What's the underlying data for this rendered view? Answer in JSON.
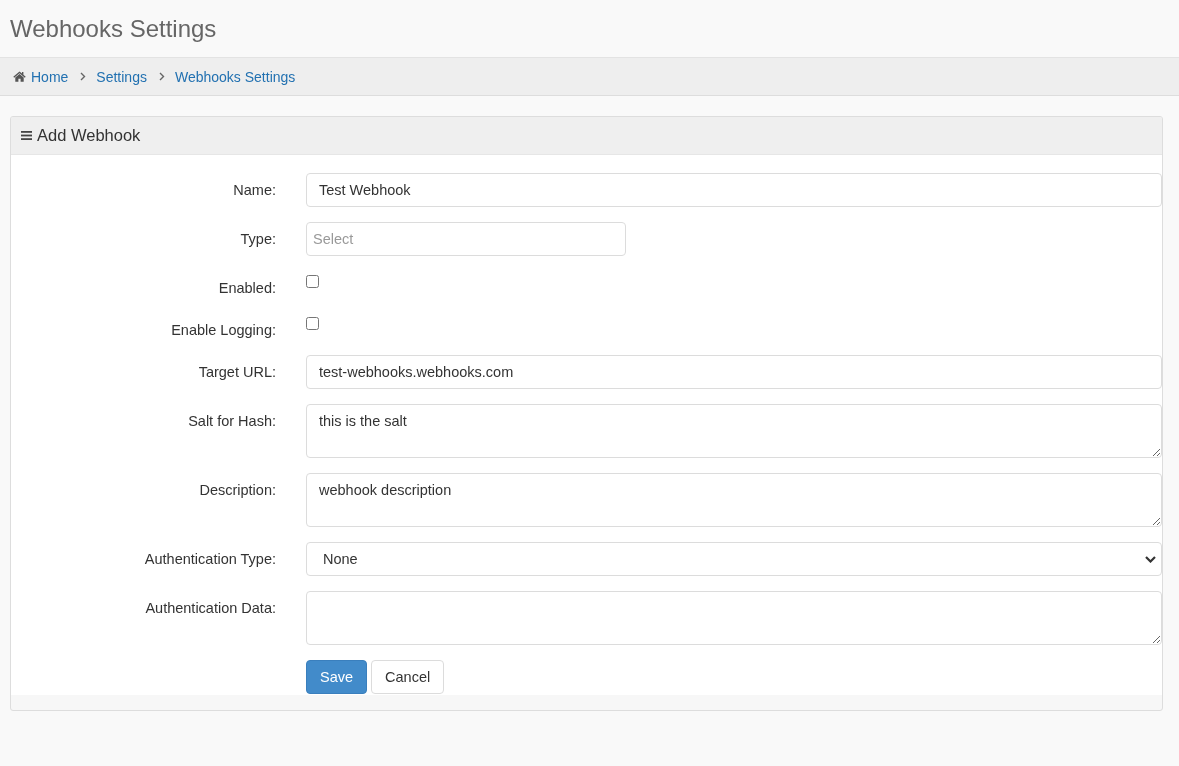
{
  "page_title": "Webhooks Settings",
  "breadcrumb": [
    {
      "label": "Home",
      "kind": "home"
    },
    {
      "label": "Settings",
      "kind": "link"
    },
    {
      "label": "Webhooks Settings",
      "kind": "link"
    }
  ],
  "panel": {
    "title": "Add Webhook",
    "fields": [
      {
        "kind": "text",
        "label": "Name:",
        "value": "Test Webhook"
      },
      {
        "kind": "combobox",
        "label": "Type:",
        "placeholder": "Select"
      },
      {
        "kind": "checkbox",
        "label": "Enabled:",
        "checked": false
      },
      {
        "kind": "checkbox",
        "label": "Enable Logging:",
        "checked": false
      },
      {
        "kind": "text",
        "label": "Target URL:",
        "value": "test-webhooks.webhooks.com"
      },
      {
        "kind": "textarea",
        "label": "Salt for Hash:",
        "value": "this is the salt"
      },
      {
        "kind": "textarea",
        "label": "Description:",
        "value": "webhook description"
      },
      {
        "kind": "select",
        "label": "Authentication Type:",
        "value": "None"
      },
      {
        "kind": "textarea",
        "label": "Authentication Data:"
      }
    ],
    "buttons": [
      {
        "label": "Save",
        "kind": "primary"
      },
      {
        "label": "Cancel",
        "kind": "default"
      }
    ]
  }
}
